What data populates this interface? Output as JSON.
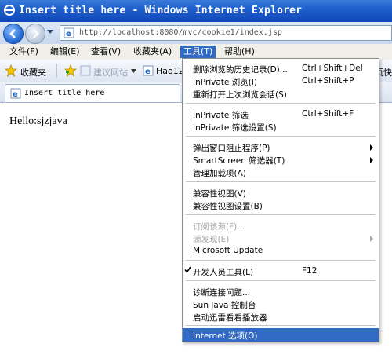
{
  "window": {
    "title": "Insert title here - Windows Internet Explorer"
  },
  "address_bar": {
    "url": "http://localhost:8080/mvc/cookie1/index.jsp"
  },
  "menubar": {
    "items": [
      "文件(F)",
      "编辑(E)",
      "查看(V)",
      "收藏夹(A)",
      "工具(T)",
      "帮助(H)"
    ]
  },
  "favorites_bar": {
    "label": "收藏夹",
    "links": [
      "建议网站",
      "Hao12",
      "页快"
    ]
  },
  "tab": {
    "title": "Insert title here"
  },
  "page": {
    "body_text": "Hello:sjzjava"
  },
  "tools_menu": {
    "items": [
      {
        "label": "删除浏览的历史记录(D)...",
        "shortcut": "Ctrl+Shift+Del"
      },
      {
        "label": "InPrivate 浏览(I)",
        "shortcut": "Ctrl+Shift+P"
      },
      {
        "label": "重新打开上次浏览会话(S)",
        "shortcut": ""
      },
      {
        "label": "InPrivate 筛选",
        "shortcut": "Ctrl+Shift+F"
      },
      {
        "label": "InPrivate 筛选设置(S)",
        "shortcut": ""
      },
      {
        "label": "弹出窗口阻止程序(P)",
        "shortcut": ""
      },
      {
        "label": "SmartScreen 筛选器(T)",
        "shortcut": ""
      },
      {
        "label": "管理加载项(A)",
        "shortcut": ""
      },
      {
        "label": "兼容性视图(V)",
        "shortcut": ""
      },
      {
        "label": "兼容性视图设置(B)",
        "shortcut": ""
      },
      {
        "label": "订阅该源(F)...",
        "shortcut": ""
      },
      {
        "label": "源发现(E)",
        "shortcut": ""
      },
      {
        "label": "Microsoft Update",
        "shortcut": ""
      },
      {
        "label": "开发人员工具(L)",
        "shortcut": "F12"
      },
      {
        "label": "诊断连接问题...",
        "shortcut": ""
      },
      {
        "label": "Sun Java 控制台",
        "shortcut": ""
      },
      {
        "label": "启动迅雷看看播放器",
        "shortcut": ""
      },
      {
        "label": "Internet 选项(O)",
        "shortcut": ""
      }
    ]
  },
  "colors": {
    "titlebar": "#1f5fcc",
    "menu_highlight": "#316ac5",
    "disabled_text": "#a7a7a7"
  }
}
